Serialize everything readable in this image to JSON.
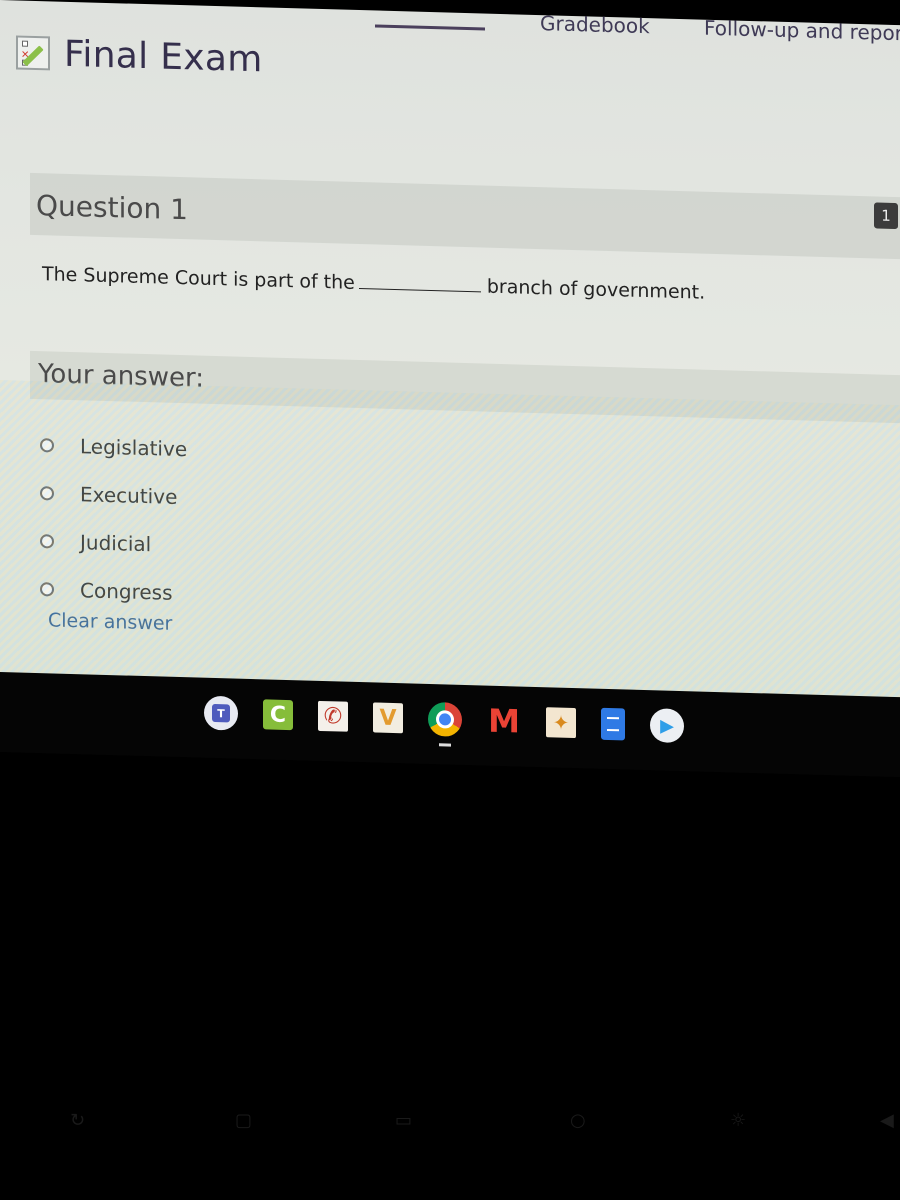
{
  "nav": {
    "tabs": [
      {
        "label": "Gradebook"
      },
      {
        "label": "Follow-up and repor"
      }
    ]
  },
  "exam": {
    "icon": "quiz-checklist-icon",
    "title": "Final Exam"
  },
  "question": {
    "title": "Question 1",
    "number_badge": "1",
    "text_before": "The Supreme Court is part of the",
    "text_after": "branch of government."
  },
  "answer": {
    "label": "Your answer:",
    "options": [
      {
        "label": "Legislative",
        "selected": false
      },
      {
        "label": "Executive",
        "selected": false
      },
      {
        "label": "Judicial",
        "selected": false
      },
      {
        "label": "Congress",
        "selected": false
      }
    ],
    "clear_label": "Clear answer"
  },
  "shelf": {
    "apps": [
      {
        "name": "Microsoft Teams",
        "icon": "teams-icon",
        "glyph": "T"
      },
      {
        "name": "Classkick",
        "icon": "classkick-icon",
        "glyph": "C"
      },
      {
        "name": "Phone app",
        "icon": "phone-app-icon",
        "glyph": "✆"
      },
      {
        "name": "Vocabulary app",
        "icon": "v-app-icon",
        "glyph": "V"
      },
      {
        "name": "Google Chrome",
        "icon": "chrome-icon",
        "glyph": ""
      },
      {
        "name": "Gmail",
        "icon": "gmail-icon",
        "glyph": "M"
      },
      {
        "name": "Fox app",
        "icon": "fox-app-icon",
        "glyph": "✦"
      },
      {
        "name": "Google Docs",
        "icon": "docs-icon",
        "glyph": ""
      },
      {
        "name": "Google Play",
        "icon": "play-store-icon",
        "glyph": "▶"
      }
    ]
  }
}
